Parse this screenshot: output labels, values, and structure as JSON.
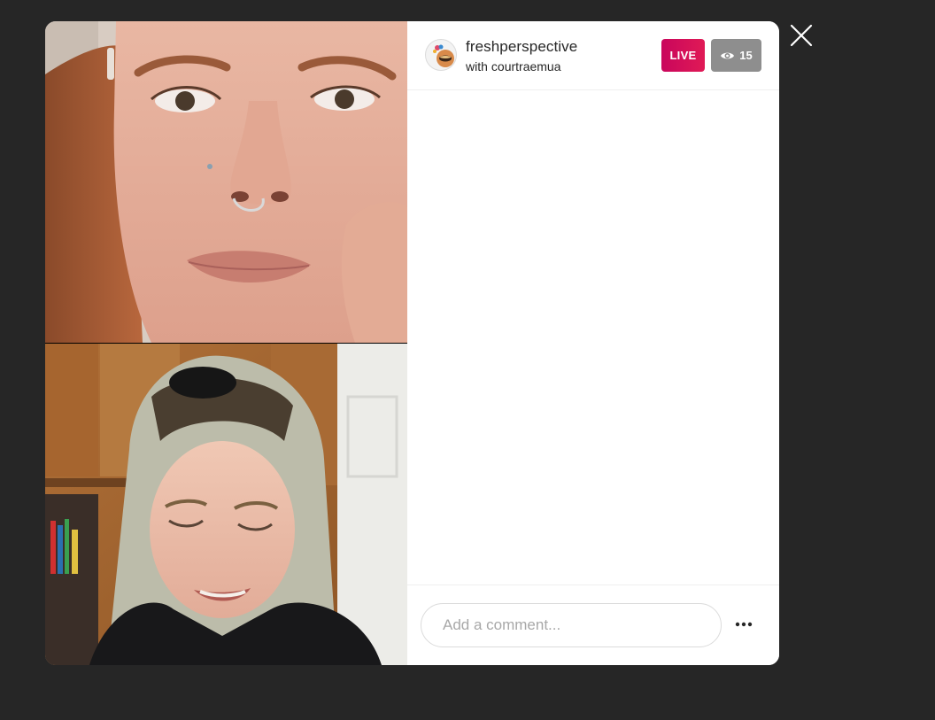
{
  "broadcast": {
    "host_username": "freshperspective",
    "with_prefix": "with",
    "guest_username": "courtraemua",
    "live_label": "LIVE",
    "viewer_count": "15"
  },
  "comment_box": {
    "placeholder": "Add a comment...",
    "value": ""
  },
  "icons": {
    "close": "close-icon",
    "eye": "eye-icon",
    "more": "more-options-icon",
    "avatar": "host-avatar"
  },
  "colors": {
    "backdrop": "#262626",
    "live_badge": "#d3115a",
    "viewer_badge": "#8e8e8e",
    "panel": "#ffffff"
  }
}
